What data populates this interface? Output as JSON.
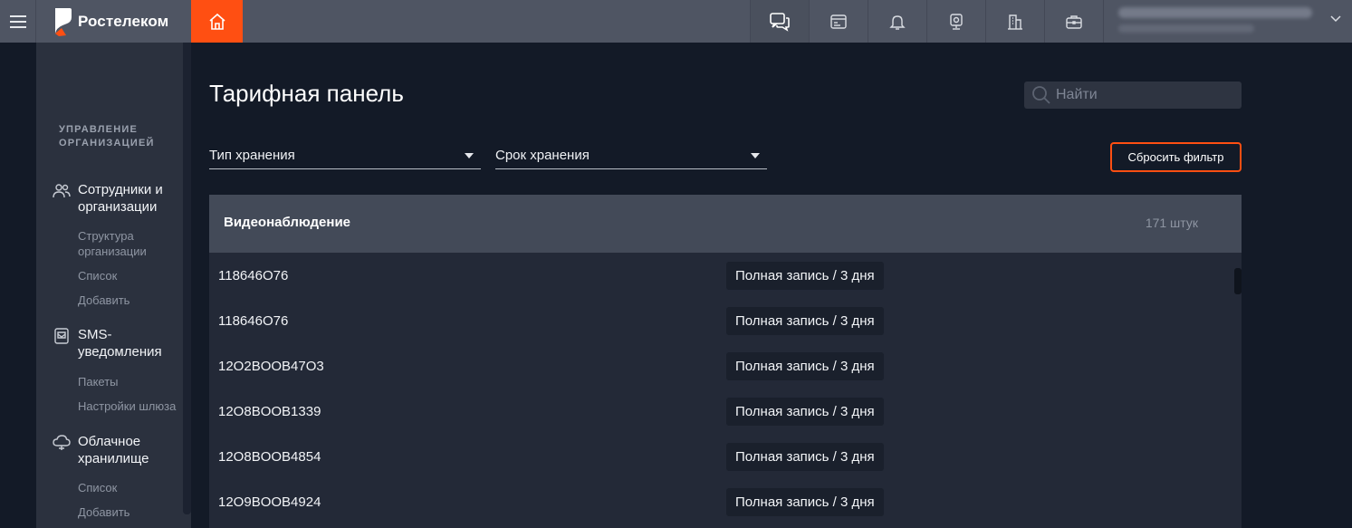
{
  "brand": {
    "name": "Ростелеком",
    "accent": "#ff4f12"
  },
  "topbar": {
    "icons": [
      "chat-icon",
      "billing-icon",
      "bell-icon",
      "camera-icon",
      "building-icon",
      "briefcase-icon"
    ],
    "user": {
      "email": "",
      "org": ""
    }
  },
  "sidebar": {
    "section_title": "УПРАВЛЕНИЕ ОРГАНИЗАЦИЕЙ",
    "groups": [
      {
        "label": "Сотрудники и организации",
        "icon": "users-icon",
        "items": [
          {
            "label": "Структура организации"
          },
          {
            "label": "Список"
          },
          {
            "label": "Добавить"
          }
        ]
      },
      {
        "label": "SMS-уведомления",
        "icon": "sms-icon",
        "items": [
          {
            "label": "Пакеты"
          },
          {
            "label": "Настройки шлюза"
          }
        ]
      },
      {
        "label": "Облачное хранилище",
        "icon": "cloud-icon",
        "items": [
          {
            "label": "Список"
          },
          {
            "label": "Добавить"
          }
        ]
      }
    ]
  },
  "main": {
    "title": "Тарифная панель",
    "search": {
      "placeholder": "Найти"
    },
    "filters": {
      "storage_type": "Тип хранения",
      "storage_term": "Срок хранения"
    },
    "reset_label": "Сбросить фильтр",
    "table": {
      "title": "Видеонаблюдение",
      "count": "171 штук",
      "rows": [
        {
          "id": "118646O76",
          "plan": "Полная запись / 3 дня"
        },
        {
          "id": "118646O76",
          "plan": "Полная запись / 3 дня"
        },
        {
          "id": "12O2BOOB47O3",
          "plan": "Полная запись / 3 дня"
        },
        {
          "id": "12O8BOOB1339",
          "plan": "Полная запись / 3 дня"
        },
        {
          "id": "12O8BOOB4854",
          "plan": "Полная запись / 3 дня"
        },
        {
          "id": "12O9BOOB4924",
          "plan": "Полная запись / 3 дня"
        }
      ]
    }
  }
}
